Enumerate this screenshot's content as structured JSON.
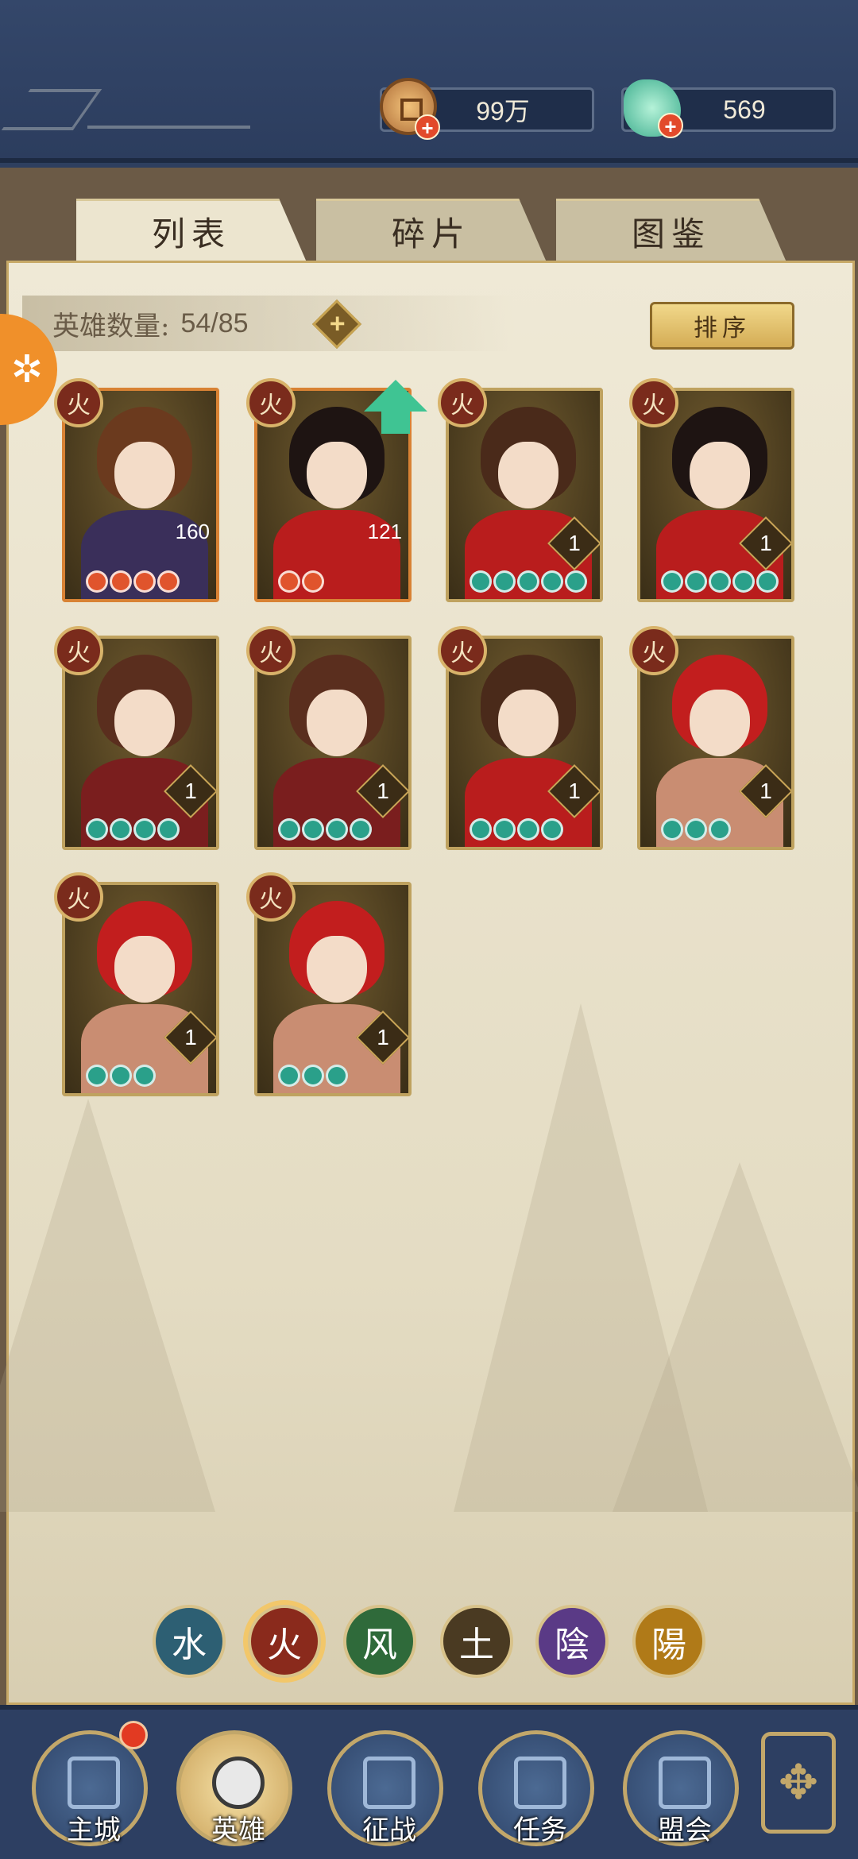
{
  "resources": {
    "coins": "99万",
    "jade": "569"
  },
  "tabs": [
    {
      "label": "列表",
      "active": true
    },
    {
      "label": "碎片",
      "active": false
    },
    {
      "label": "图鉴",
      "active": false
    }
  ],
  "hero_count": {
    "label": "英雄数量:",
    "value": "54/85"
  },
  "sort_label": "排序",
  "element_tag": "火",
  "heroes": [
    {
      "level": "160",
      "stars": 4,
      "star_color": "red"
    },
    {
      "level": "121",
      "stars": 2,
      "star_color": "red"
    },
    {
      "level": "1",
      "stars": 5,
      "star_color": "green"
    },
    {
      "level": "1",
      "stars": 5,
      "star_color": "green"
    },
    {
      "level": "1",
      "stars": 4,
      "star_color": "green"
    },
    {
      "level": "1",
      "stars": 4,
      "star_color": "green"
    },
    {
      "level": "1",
      "stars": 4,
      "star_color": "green"
    },
    {
      "level": "1",
      "stars": 3,
      "star_color": "green"
    },
    {
      "level": "1",
      "stars": 3,
      "star_color": "green"
    },
    {
      "level": "1",
      "stars": 3,
      "star_color": "green"
    }
  ],
  "element_filters": [
    {
      "label": "水",
      "color": "#2d5f73",
      "active": false
    },
    {
      "label": "火",
      "color": "#8a2a1c",
      "active": true
    },
    {
      "label": "风",
      "color": "#2f6a3a",
      "active": false
    },
    {
      "label": "土",
      "color": "#4a3a22",
      "active": false
    },
    {
      "label": "陰",
      "color": "#5a3a86",
      "active": false
    },
    {
      "label": "陽",
      "color": "#b07a18",
      "active": false
    }
  ],
  "nav": [
    {
      "label": "主城",
      "active": false
    },
    {
      "label": "英雄",
      "active": true
    },
    {
      "label": "征战",
      "active": false
    },
    {
      "label": "任务",
      "active": false
    },
    {
      "label": "盟会",
      "active": false
    }
  ],
  "colors": {
    "topbar": "#34476a",
    "panel": "#efe9d6",
    "accent_gold": "#c7a967",
    "fire": "#7a2b1c"
  }
}
